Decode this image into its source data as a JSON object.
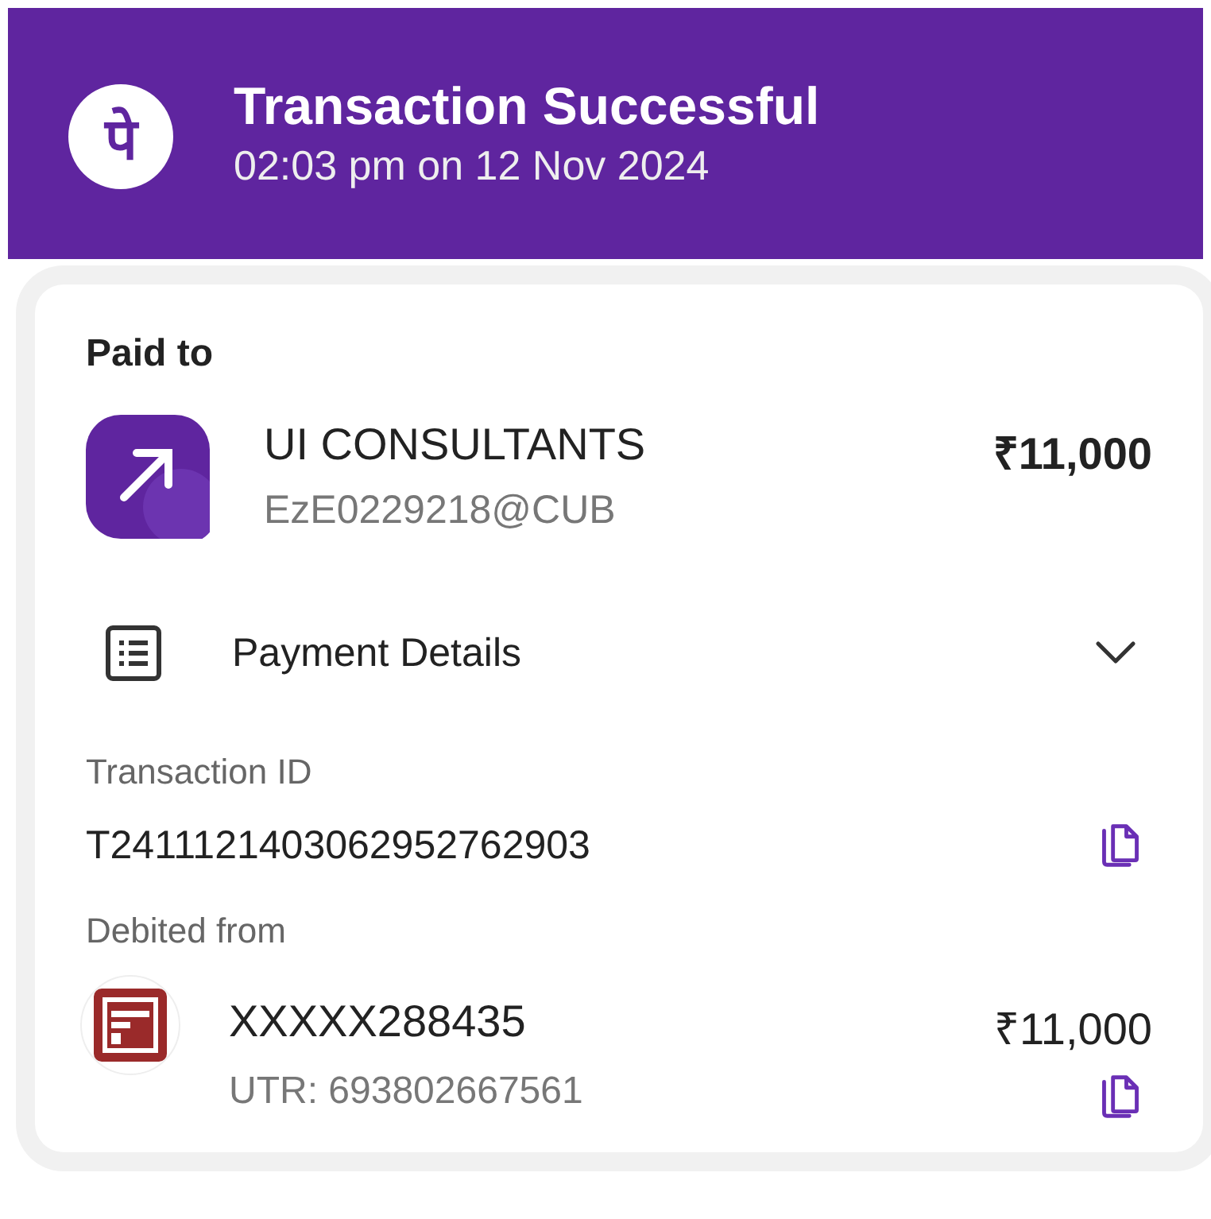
{
  "header": {
    "logo": "पे",
    "title": "Transaction Successful",
    "subtitle": "02:03 pm on 12 Nov 2024"
  },
  "paid_to": {
    "label": "Paid to",
    "name": "UI CONSULTANTS",
    "upi_id": "EzE0229218@CUB",
    "amount": "₹11,000"
  },
  "payment_details": {
    "label": "Payment Details",
    "expanded": true,
    "transaction_id": {
      "label": "Transaction ID",
      "value": "T2411121403062952762903"
    },
    "debited_from": {
      "label": "Debited from",
      "account": "XXXXX288435",
      "utr": "UTR: 693802667561",
      "amount": "₹11,000"
    }
  }
}
